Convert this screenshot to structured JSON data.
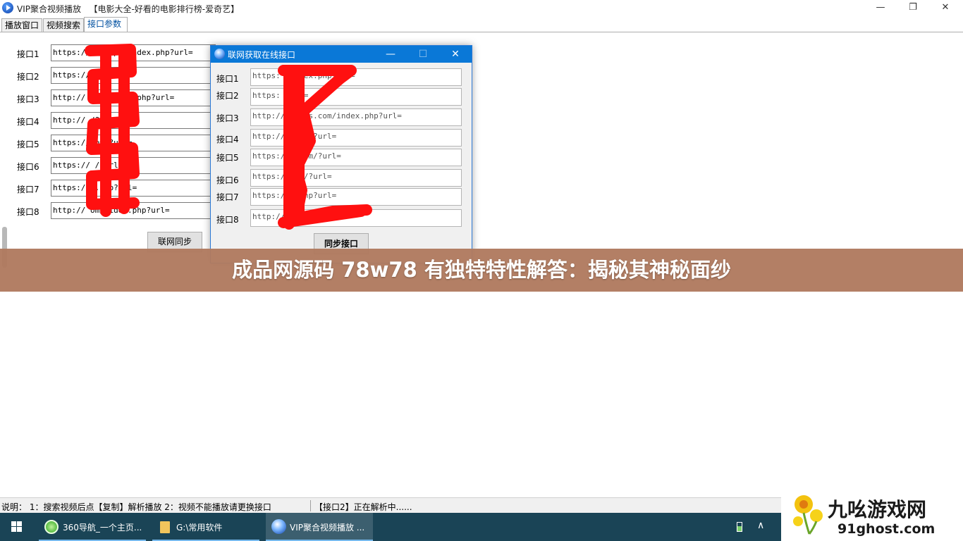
{
  "window": {
    "title": "VIP聚合视频播放",
    "subtitle": "【电影大全-好看的电影排行榜-爱奇艺】",
    "minimize": "—",
    "restore": "❐",
    "close": "✕"
  },
  "tabs": [
    {
      "label": "播放窗口"
    },
    {
      "label": "视频搜索"
    },
    {
      "label": "接口参数"
    }
  ],
  "interfaces": [
    {
      "label": "接口1",
      "value": "https://          om/api/index.php?url="
    },
    {
      "label": "接口2",
      "value": "https://          rl="
    },
    {
      "label": "接口3",
      "value": "http://          com/index.php?url="
    },
    {
      "label": "接口4",
      "value": "http://          /?url="
    },
    {
      "label": "接口5",
      "value": "https://          om/?url="
    },
    {
      "label": "接口6",
      "value": "https://          /?url="
    },
    {
      "label": "接口7",
      "value": "https://          .php?url="
    },
    {
      "label": "接口8",
      "value": "http://          om/video.php?url="
    }
  ],
  "sync_button": "联网同步",
  "dialog": {
    "title": "联网获取在线接口",
    "minimize": "—",
    "maximize": "☐",
    "close": "✕",
    "items": [
      {
        "label": "接口1",
        "value": "https:          /index.php?url="
      },
      {
        "label": "接口2",
        "value": "https:          ?url="
      },
      {
        "label": "接口3",
        "value": "http://     ingys.com/index.php?url="
      },
      {
        "label": "接口4",
        "value": "http://          .com/?url="
      },
      {
        "label": "接口5",
        "value": "https://         .com/?url="
      },
      {
        "label": "接口6",
        "value": "https://         om/?url="
      },
      {
        "label": "接口7",
        "value": "https://          .php?url="
      },
      {
        "label": "接口8",
        "value": "http://          .php?url="
      }
    ],
    "sync_button": "同步接口"
  },
  "banner": "成品网源码 78w78 有独特特性解答：揭秘其神秘面纱",
  "status": {
    "help": "说明： 1：搜索视频后点【复制】解析播放 2：视频不能播放请更换接口",
    "state": "【接口2】正在解析中......"
  },
  "taskbar": {
    "items": [
      {
        "label": "360导航_一个主页..."
      },
      {
        "label": "G:\\常用软件"
      },
      {
        "label": "VIP聚合视频播放  ..."
      }
    ],
    "tray_chevron": "∧"
  },
  "watermark": {
    "title": "九吆游戏网",
    "url": "91ghost.com"
  },
  "colors": {
    "dialog_title_bg": "#0a78d7",
    "banner_bg": "#b07a5f",
    "taskbar_bg": "#1a4456",
    "scribble": "#ff1010",
    "active_tab_text": "#0050a0"
  }
}
